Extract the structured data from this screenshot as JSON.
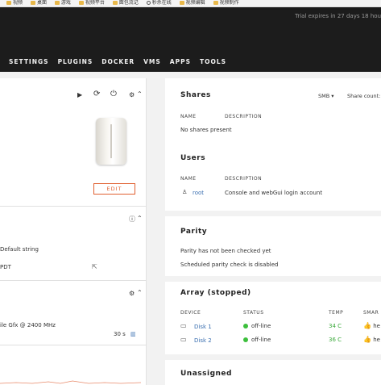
{
  "bookmarks": [
    "视频",
    "桌面",
    "游戏",
    "视频平台",
    "面包流记",
    "秒杀在线",
    "视频编辑",
    "视频制作"
  ],
  "trial_text": "Trial expires in 27 days 18 hou",
  "nav": [
    "SETTINGS",
    "PLUGINS",
    "DOCKER",
    "VMS",
    "APPS",
    "TOOLS"
  ],
  "left": {
    "edit_label": "EDIT",
    "motherboard": "Default string",
    "timezone": "PDT",
    "cpu": "ile Gfx @ 2400 MHz",
    "interval": "30 s"
  },
  "shares": {
    "title": "Shares",
    "protocol": "SMB",
    "count_label": "Share count:",
    "col_name": "NAME",
    "col_desc": "DESCRIPTION",
    "empty": "No shares present"
  },
  "users": {
    "title": "Users",
    "col_name": "NAME",
    "col_desc": "DESCRIPTION",
    "rows": [
      {
        "name": "root",
        "desc": "Console and webGui login account"
      }
    ]
  },
  "parity": {
    "title": "Parity",
    "line1": "Parity has not been checked yet",
    "line2": "Scheduled parity check is disabled"
  },
  "array": {
    "title": "Array (stopped)",
    "cols": [
      "DEVICE",
      "STATUS",
      "TEMP",
      "SMAR"
    ],
    "rows": [
      {
        "device": "Disk 1",
        "status": "off-line",
        "temp": "34 C",
        "smart": "he"
      },
      {
        "device": "Disk 2",
        "status": "off-line",
        "temp": "36 C",
        "smart": "he"
      }
    ]
  },
  "unassigned": {
    "title": "Unassigned"
  }
}
